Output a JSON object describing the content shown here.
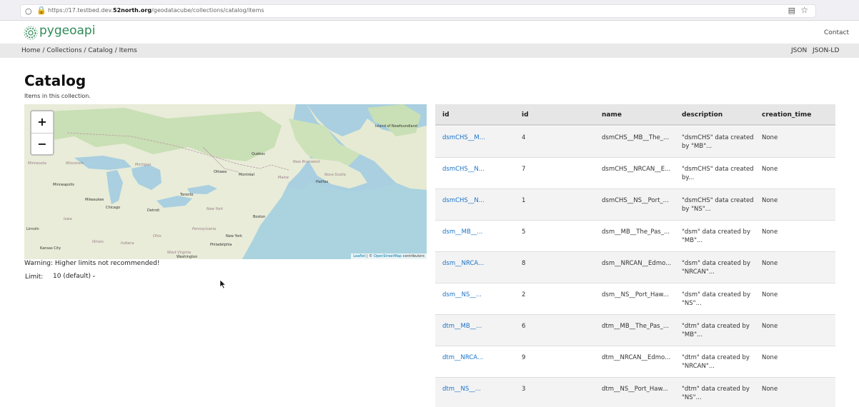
{
  "browser": {
    "url_prefix": "https://17.testbed.dev.",
    "url_domain": "52north.org",
    "url_path": "/geodatacube/collections/catalog/items"
  },
  "header": {
    "brand": "pygeoapi",
    "contact": "Contact"
  },
  "breadcrumb": {
    "text": "Home / Collections / Catalog / Items",
    "json": "JSON",
    "jsonld": "JSON-LD"
  },
  "page": {
    "title": "Catalog",
    "subtitle": "Items in this collection."
  },
  "map": {
    "zoom_in": "+",
    "zoom_out": "−",
    "attribution_leaflet": "Leaflet",
    "attribution_sep": " | © ",
    "attribution_osm": "OpenStreetMap",
    "attribution_tail": " contributors",
    "labels": {
      "island": "Island of Newfoundland",
      "quebec": "Québec",
      "ottawa": "Ottawa",
      "montreal": "Montréal",
      "halifax": "Halifax",
      "minneapolis": "Minneapolis",
      "milwaukee": "Milwaukee",
      "toronto": "Toronto",
      "detroit": "Detroit",
      "chicago": "Chicago",
      "newyork_state": "New York",
      "boston": "Boston",
      "lincoln": "Lincoln",
      "iowa": "Iowa",
      "illinois": "Illinois",
      "indiana": "Indiana",
      "ohio": "Ohio",
      "pennsylvania": "Pennsylvania",
      "newyork": "New York",
      "philadelphia": "Philadelphia",
      "kansas": "Kansas City",
      "westvirginia": "West Virginia",
      "washington": "Washington",
      "wisconsin": "Wisconsin",
      "michigan": "Michigan",
      "minnesota": "Minnesota",
      "maine": "Maine",
      "newbrunswick": "New Brunswick",
      "novascotia": "Nova Scotia"
    }
  },
  "controls": {
    "warning": "Warning: Higher limits not recommended!",
    "limit_label": "Limit:",
    "limit_value": "10 (default)"
  },
  "table": {
    "headers": [
      "id",
      "id",
      "name",
      "description",
      "creation_time"
    ],
    "rows": [
      {
        "link": "dsmCHS__M...",
        "id": "4",
        "name": "dsmCHS__MB__The_...",
        "desc1": "\"dsmCHS\" data created",
        "desc2": "by \"MB\"...",
        "time": "None"
      },
      {
        "link": "dsmCHS__N...",
        "id": "7",
        "name": "dsmCHS__NRCAN__E...",
        "desc1": "\"dsmCHS\" data created",
        "desc2": "by...",
        "time": "None"
      },
      {
        "link": "dsmCHS__N...",
        "id": "1",
        "name": "dsmCHS__NS__Port_...",
        "desc1": "\"dsmCHS\" data created",
        "desc2": "by \"NS\"...",
        "time": "None"
      },
      {
        "link": "dsm__MB__...",
        "id": "5",
        "name": "dsm__MB__The_Pas_...",
        "desc1": "\"dsm\" data created by",
        "desc2": "\"MB\"...",
        "time": "None"
      },
      {
        "link": "dsm__NRCA...",
        "id": "8",
        "name": "dsm__NRCAN__Edmo...",
        "desc1": "\"dsm\" data created by",
        "desc2": "\"NRCAN\"...",
        "time": "None"
      },
      {
        "link": "dsm__NS__...",
        "id": "2",
        "name": "dsm__NS__Port_Haw...",
        "desc1": "\"dsm\" data created by",
        "desc2": "\"NS\"...",
        "time": "None"
      },
      {
        "link": "dtm__MB__...",
        "id": "6",
        "name": "dtm__MB__The_Pas_...",
        "desc1": "\"dtm\" data created by",
        "desc2": "\"MB\"...",
        "time": "None"
      },
      {
        "link": "dtm__NRCA...",
        "id": "9",
        "name": "dtm__NRCAN__Edmo...",
        "desc1": "\"dtm\" data created by",
        "desc2": "\"NRCAN\"...",
        "time": "None"
      },
      {
        "link": "dtm__NS__...",
        "id": "3",
        "name": "dtm__NS__Port_Haw...",
        "desc1": "\"dtm\" data created by",
        "desc2": "\"NS\"...",
        "time": "None"
      }
    ]
  },
  "colors": {
    "brand": "#2e8b57",
    "link": "#1a73c8",
    "water": "#a9cfe0",
    "land": "#e8ecd8",
    "forest": "#c9dfb5"
  }
}
